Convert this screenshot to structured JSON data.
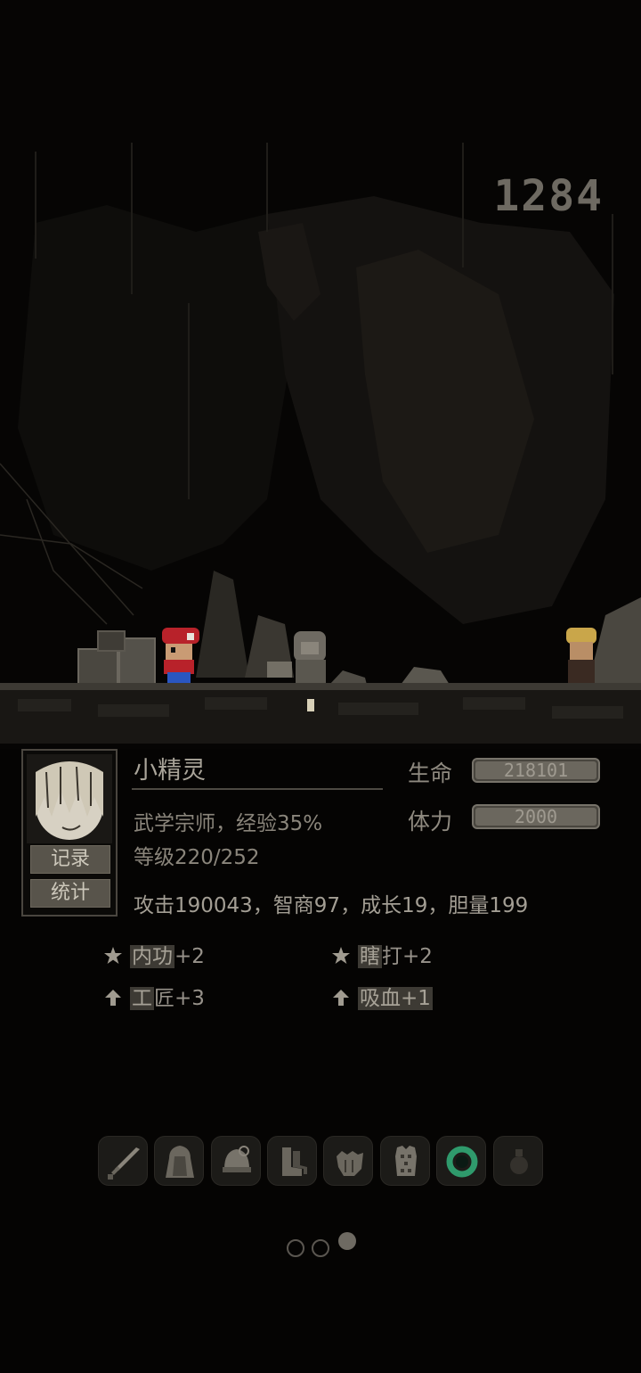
{
  "hud": {
    "score": "1284"
  },
  "character": {
    "name": "小精灵",
    "title_line": "武学宗师，经验35%",
    "level_line": "等级220/252",
    "hp_label": "生命",
    "hp_value": "218101",
    "hp_fraction": 1.0,
    "stamina_label": "体力",
    "stamina_value": "2000",
    "stamina_fraction": 1.0,
    "attack_line": "攻击190043，智商97，成长19，胆量199"
  },
  "portrait_buttons": {
    "record": "记录",
    "stats": "统计"
  },
  "skills": [
    {
      "icon": "star-icon",
      "highlight": "内功",
      "rest": "+2"
    },
    {
      "icon": "star-icon",
      "highlight": "瞎",
      "rest": "打+2"
    },
    {
      "icon": "arrow-up-icon",
      "highlight": "工",
      "rest": "匠+3"
    },
    {
      "icon": "arrow-up-icon",
      "highlight": "吸血+1",
      "rest": ""
    }
  ],
  "equipment": [
    {
      "icon": "sword-icon"
    },
    {
      "icon": "cloak-icon"
    },
    {
      "icon": "helmet-icon"
    },
    {
      "icon": "boots-icon"
    },
    {
      "icon": "gloves-icon"
    },
    {
      "icon": "armor-icon"
    },
    {
      "icon": "ring-icon",
      "color": "#2f9a6c"
    },
    {
      "icon": "potion-icon"
    }
  ],
  "pager": {
    "current": 3,
    "total": 3
  },
  "colors": {
    "background": "#050403",
    "panel_text": "#9a958c",
    "ring": "#2f9a6c"
  }
}
